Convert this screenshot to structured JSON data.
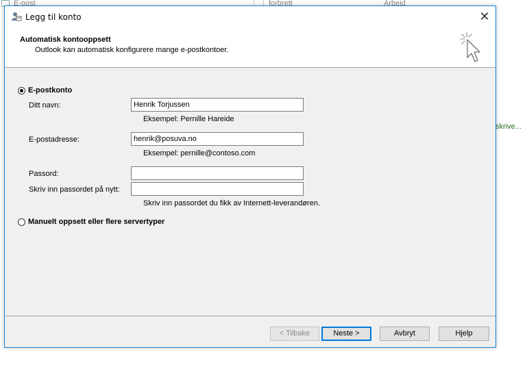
{
  "background": {
    "tab1": "E-post",
    "tab2": "forbrett",
    "tab3": "Arbeid",
    "side_text": "skrive..."
  },
  "dialog": {
    "title": "Legg til konto",
    "close_glyph": "✕",
    "header": {
      "title": "Automatisk kontooppsett",
      "subtitle": "Outlook kan automatisk konfigurere mange e-postkontoer."
    },
    "email_account": {
      "label": "E-postkonto",
      "selected": true
    },
    "fields": {
      "name": {
        "label": "Ditt navn:",
        "value": "Henrik Torjussen",
        "hint": "Eksempel: Pernille Hareide"
      },
      "email": {
        "label": "E-postadresse:",
        "value": "henrik@posuva.no",
        "hint": "Eksempel: pernille@contoso.com"
      },
      "password": {
        "label": "Passord:",
        "value": ""
      },
      "password_repeat": {
        "label": "Skriv inn passordet på nytt:",
        "value": "",
        "hint": "Skriv inn passordet du fikk av Internett-leverandøren."
      }
    },
    "manual_setup": {
      "label": "Manuelt oppsett eller flere servertyper",
      "selected": false
    },
    "buttons": {
      "back": "< Tilbake",
      "next": "Neste >",
      "cancel": "Avbryt",
      "help": "Hjelp"
    }
  },
  "colors": {
    "accent": "#0078d7",
    "dialog_bg": "#f0f0f0",
    "side_text": "#2a6f2a"
  }
}
